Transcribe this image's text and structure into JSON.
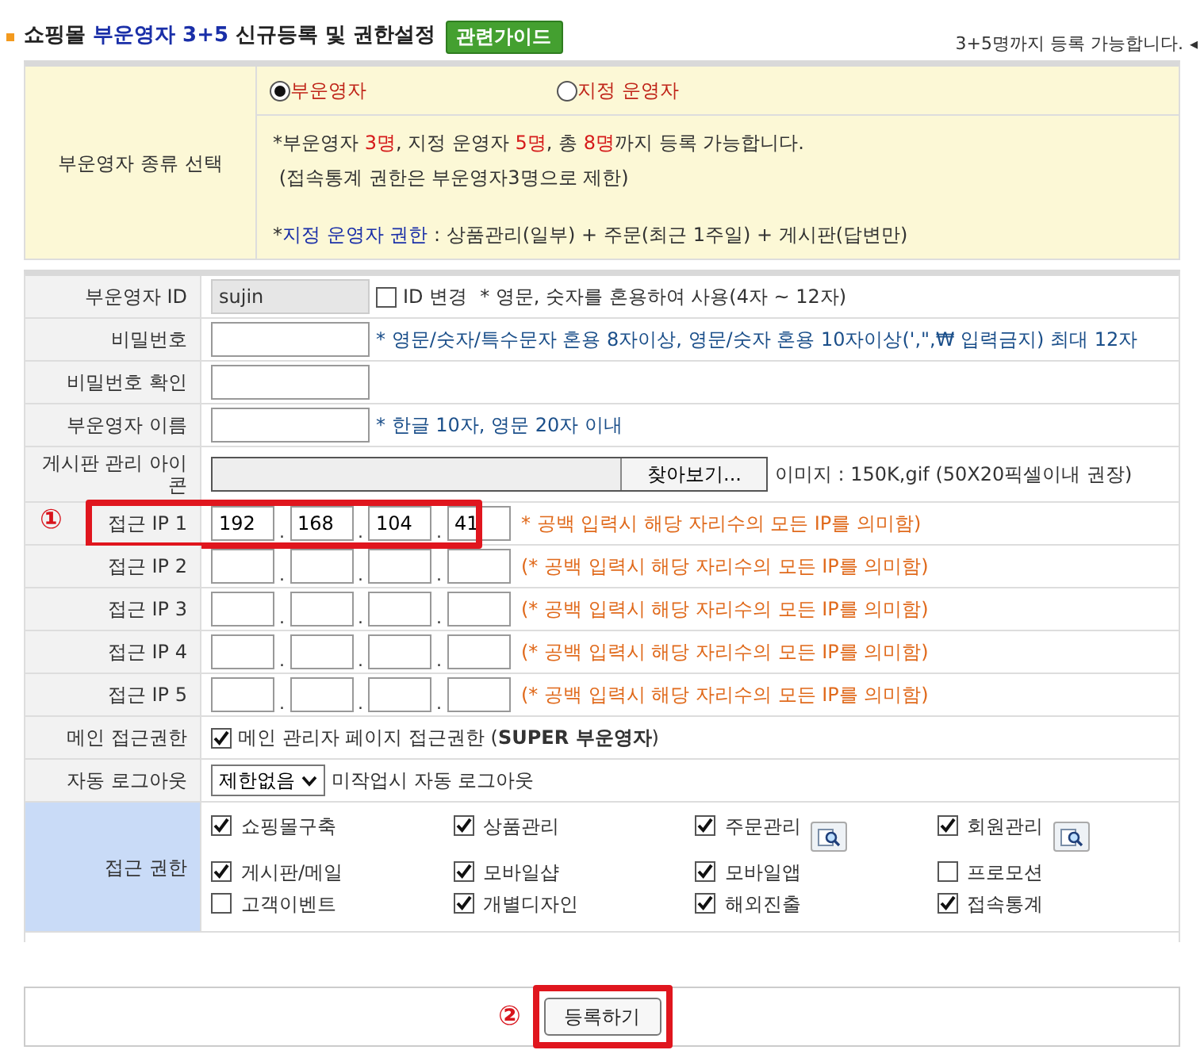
{
  "header": {
    "title_prefix": "쇼핑몰",
    "title_highlight": "부운영자 3+5",
    "title_suffix": "신규등록 및 권한설정",
    "guide_button": "관련가이드",
    "note": "3+5명까지 등록 가능합니다.",
    "note_arrow": "◂"
  },
  "type_section": {
    "label": "부운영자 종류 선택",
    "options": [
      {
        "label": "부운영자",
        "selected": true
      },
      {
        "label": "지정 운영자",
        "selected": false
      }
    ],
    "lines": [
      [
        {
          "text": "*부운영자 ",
          "kind": "plain"
        },
        {
          "text": "3명",
          "kind": "count"
        },
        {
          "text": ", 지정 운영자 ",
          "kind": "plain"
        },
        {
          "text": "5명",
          "kind": "count"
        },
        {
          "text": ", 총 ",
          "kind": "plain"
        },
        {
          "text": "8명",
          "kind": "count"
        },
        {
          "text": "까지 등록 가능합니다.",
          "kind": "plain"
        }
      ],
      [
        {
          "text": " (접속통계 권한은 부운영자3명으로 제한)",
          "kind": "plain"
        }
      ],
      [
        {
          "text": "*",
          "kind": "plain"
        },
        {
          "text": "지정 운영자 권한",
          "kind": "term"
        },
        {
          "text": " : 상품관리(일부) + 주문(최근 1주일) + 게시판(답변만)",
          "kind": "plain"
        }
      ]
    ]
  },
  "form_rows": [
    {
      "kind": "id",
      "label": "부운영자 ID",
      "value": "sujin",
      "checkbox_label": "ID 변경",
      "checked": false,
      "hint": "* 영문, 숫자를 혼용하여 사용(4자 ~ 12자)"
    },
    {
      "kind": "text",
      "label": "비밀번호",
      "hint": "* 영문/숫자/특수문자 혼용 8자이상, 영문/숫자 혼용 10자이상(',\",₩ 입력금지) 최대 12자"
    },
    {
      "kind": "text",
      "label": "비밀번호 확인"
    },
    {
      "kind": "text",
      "label": "부운영자 이름",
      "hint": "* 한글 10자, 영문 20자 이내"
    },
    {
      "kind": "file",
      "label": "게시판 관리 아이콘",
      "button": "찾아보기...",
      "hint": "이미지 : 150K,gif (50X20픽셀이내 권장)"
    },
    {
      "kind": "ip",
      "label": "접근 IP 1",
      "values": [
        "192",
        "168",
        "104",
        "41"
      ],
      "separator": ".",
      "hint": "* 공백 입력시 해당 자리수의 모든 IP를 의미함)",
      "callout": "①"
    },
    {
      "kind": "ip",
      "label": "접근 IP 2",
      "separator": ".",
      "hint": "(* 공백 입력시 해당 자리수의 모든 IP를 의미함)"
    },
    {
      "kind": "ip",
      "label": "접근 IP 3",
      "separator": ".",
      "hint": "(* 공백 입력시 해당 자리수의 모든 IP를 의미함)"
    },
    {
      "kind": "ip",
      "label": "접근 IP 4",
      "separator": ".",
      "hint": "(* 공백 입력시 해당 자리수의 모든 IP를 의미함)"
    },
    {
      "kind": "ip",
      "label": "접근 IP 5",
      "separator": ".",
      "hint": "(* 공백 입력시 해당 자리수의 모든 IP를 의미함)"
    },
    {
      "kind": "checkbox",
      "label": "메인 접근권한",
      "checked": true,
      "text": "메인 관리자 페이지 접근권한 (",
      "bold_text": "SUPER 부운영자",
      "text_end": ")"
    },
    {
      "kind": "select",
      "label": "자동 로그아웃",
      "value": "제한없음",
      "hint": "미작업시 자동 로그아웃"
    },
    {
      "kind": "permissions",
      "label": "접근 권한",
      "items": [
        {
          "label": "쇼핑몰구축",
          "checked": true,
          "detail": false
        },
        {
          "label": "상품관리",
          "checked": true,
          "detail": false
        },
        {
          "label": "주문관리",
          "checked": true,
          "detail": true
        },
        {
          "label": "회원관리",
          "checked": true,
          "detail": true
        },
        {
          "label": "게시판/메일",
          "checked": true,
          "detail": false
        },
        {
          "label": "모바일샵",
          "checked": true,
          "detail": false
        },
        {
          "label": "모바일앱",
          "checked": true,
          "detail": false
        },
        {
          "label": "프로모션",
          "checked": false,
          "detail": false
        },
        {
          "label": "고객이벤트",
          "checked": false,
          "detail": false
        },
        {
          "label": "개별디자인",
          "checked": true,
          "detail": false
        },
        {
          "label": "해외진출",
          "checked": true,
          "detail": false
        },
        {
          "label": "접속통계",
          "checked": true,
          "detail": false
        }
      ]
    }
  ],
  "footer": {
    "callout": "②",
    "submit_button": "등록하기"
  }
}
